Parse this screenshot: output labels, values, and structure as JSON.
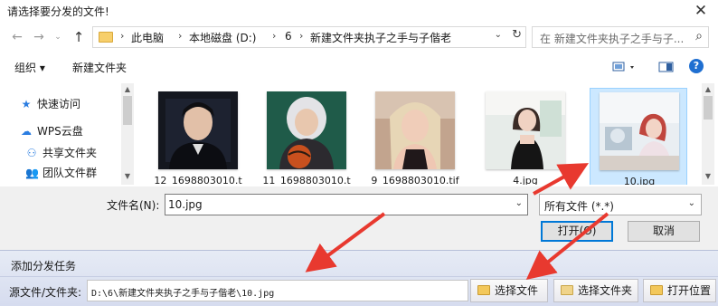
{
  "dialog": {
    "title": "请选择要分发的文件!",
    "close_glyph": "✕"
  },
  "nav": {
    "back_glyph": "←",
    "forward_glyph": "→",
    "recent_glyph": "⌄",
    "up_glyph": "↑"
  },
  "address": {
    "crumbs": [
      "此电脑",
      "本地磁盘 (D:)",
      "6",
      "新建文件夹执子之手与子偕老"
    ],
    "separator": "›",
    "dropdown_glyph": "⌄",
    "refresh_glyph": "↻"
  },
  "search": {
    "placeholder": "在 新建文件夹执子之手与子...",
    "icon_glyph": "⌕"
  },
  "toolbar": {
    "organize_label": "组织 ▾",
    "new_folder_label": "新建文件夹",
    "view_glyph": "▾",
    "help_glyph": "?"
  },
  "sidebar": {
    "items": [
      {
        "label": "快速访问",
        "icon": "star-icon",
        "glyph": "★",
        "color": "#2a7de1"
      },
      {
        "label": "WPS云盘",
        "icon": "cloud-icon",
        "glyph": "☁",
        "color": "#2a7de1"
      },
      {
        "label": "共享文件夹",
        "icon": "share-icon",
        "glyph": "⚇",
        "color": "#2a7de1"
      },
      {
        "label": "团队文件群",
        "icon": "group-icon",
        "glyph": "👥",
        "color": "#2a7de1"
      }
    ]
  },
  "files": [
    {
      "name": "12_1698803010.t",
      "selected": false
    },
    {
      "name": "11_1698803010.t",
      "selected": false
    },
    {
      "name": "9_1698803010.tif",
      "selected": false
    },
    {
      "name": "4.jpg",
      "selected": false
    },
    {
      "name": "10.jpg",
      "selected": true
    }
  ],
  "filename": {
    "label": "文件名(N):",
    "value": "10.jpg",
    "dropdown_glyph": "⌄"
  },
  "filetype": {
    "value": "所有文件 (*.*)",
    "dropdown_glyph": "⌄"
  },
  "buttons": {
    "open": "打开(O)",
    "cancel": "取消"
  },
  "task": {
    "title": "添加分发任务",
    "source_label": "源文件/文件夹:",
    "source_value": "D:\\6\\新建文件夹执子之手与子偕老\\10.jpg",
    "select_file": "选择文件",
    "select_folder": "选择文件夹",
    "open_location": "打开位置"
  },
  "colors": {
    "accent": "#0078d7",
    "annotation_arrow": "#e8392f",
    "selection_bg": "#cce8ff"
  }
}
